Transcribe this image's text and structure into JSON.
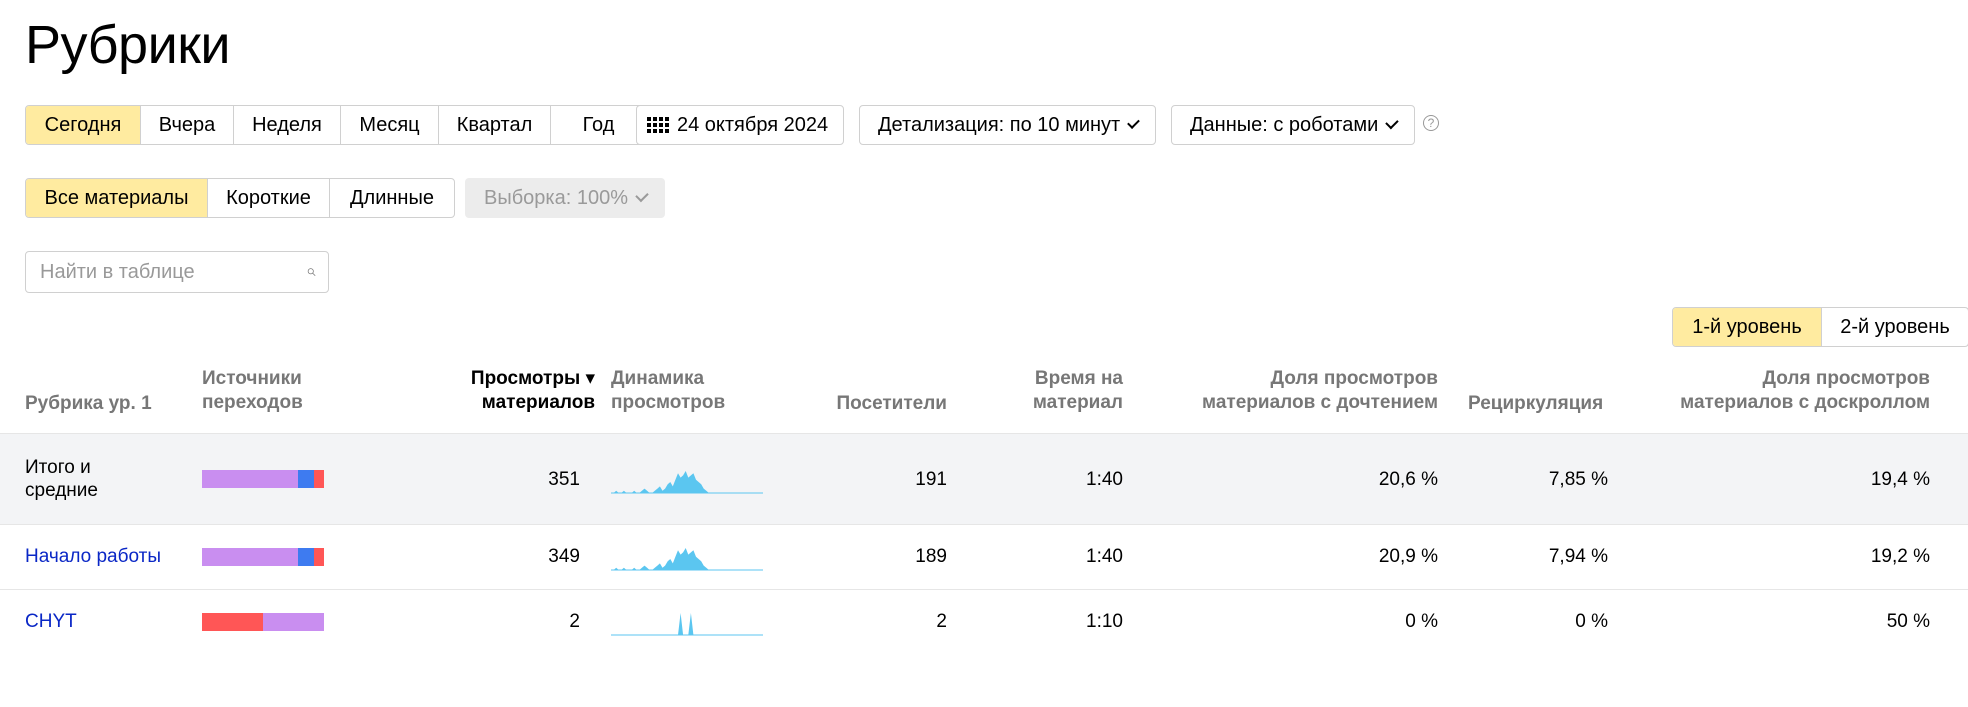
{
  "page": {
    "title": "Рубрики"
  },
  "period": {
    "options": [
      "Сегодня",
      "Вчера",
      "Неделя",
      "Месяц",
      "Квартал",
      "Год"
    ],
    "active": 0
  },
  "date": {
    "label": "24 октября 2024"
  },
  "detail": {
    "label": "Детализация: по 10 минут"
  },
  "data_mode": {
    "label": "Данные: с роботами"
  },
  "help": {
    "symbol": "?"
  },
  "materials": {
    "options": [
      "Все материалы",
      "Короткие",
      "Длинные"
    ],
    "active": 0
  },
  "sample": {
    "label": "Выборка: 100%"
  },
  "search": {
    "placeholder": "Найти в таблице"
  },
  "levels": {
    "options": [
      "1-й уровень",
      "2-й уровень"
    ],
    "active": 0
  },
  "colors": {
    "violet": "#c98ef0",
    "blue": "#3e7bf0",
    "red": "#ff5656",
    "spark": "#5bc6f0",
    "link": "#0a27c6"
  },
  "table": {
    "headers": {
      "rubric": "Рубрика ур. 1",
      "sources": [
        "Источники",
        "переходов"
      ],
      "views": [
        "Просмотры ▾",
        "материалов"
      ],
      "dynamics": [
        "Динамика",
        "просмотров"
      ],
      "visitors": "Посетители",
      "time": [
        "Время на",
        "материал"
      ],
      "read_share": [
        "Доля просмотров",
        "материалов с дочтением"
      ],
      "recirculation": "Рециркуляция",
      "scroll_share": [
        "Доля просмотров",
        "материалов с доскроллом"
      ]
    },
    "rows": [
      {
        "rubric": [
          "Итого и",
          "средние"
        ],
        "sources": [
          {
            "color": "violet",
            "share": 0.79
          },
          {
            "color": "blue",
            "share": 0.13
          },
          {
            "color": "red",
            "share": 0.08
          }
        ],
        "views": "351",
        "visitors": "191",
        "time": "1:40",
        "read_share": "20,6 %",
        "recirculation": "7,85 %",
        "scroll_share": "19,4 %",
        "spark": [
          0,
          0,
          1,
          0,
          0,
          1,
          0,
          0,
          0,
          1,
          0,
          0,
          1,
          2,
          1,
          0,
          0,
          1,
          2,
          3,
          1,
          2,
          4,
          5,
          3,
          6,
          9,
          7,
          8,
          10,
          7,
          8,
          9,
          6,
          5,
          4,
          2,
          1,
          0,
          0,
          0,
          0,
          0,
          0,
          0,
          0,
          0,
          0,
          0,
          0,
          0,
          0,
          0,
          0,
          0,
          0,
          0,
          0,
          0,
          0
        ]
      },
      {
        "rubric": [
          "Начало работы"
        ],
        "sources": [
          {
            "color": "violet",
            "share": 0.79
          },
          {
            "color": "blue",
            "share": 0.13
          },
          {
            "color": "red",
            "share": 0.08
          }
        ],
        "views": "349",
        "visitors": "189",
        "time": "1:40",
        "read_share": "20,9 %",
        "recirculation": "7,94 %",
        "scroll_share": "19,2 %",
        "spark": [
          0,
          0,
          1,
          0,
          0,
          1,
          0,
          0,
          0,
          1,
          0,
          0,
          1,
          2,
          1,
          0,
          0,
          1,
          2,
          3,
          1,
          2,
          4,
          5,
          3,
          6,
          9,
          7,
          8,
          10,
          7,
          8,
          9,
          6,
          5,
          4,
          2,
          1,
          0,
          0,
          0,
          0,
          0,
          0,
          0,
          0,
          0,
          0,
          0,
          0,
          0,
          0,
          0,
          0,
          0,
          0,
          0,
          0,
          0,
          0
        ]
      },
      {
        "rubric": [
          "CHYT"
        ],
        "sources": [
          {
            "color": "red",
            "share": 0.5
          },
          {
            "color": "violet",
            "share": 0.5
          }
        ],
        "views": "2",
        "visitors": "2",
        "time": "1:10",
        "read_share": "0 %",
        "recirculation": "0 %",
        "scroll_share": "50 %",
        "spark": [
          0,
          0,
          0,
          0,
          0,
          0,
          0,
          0,
          0,
          0,
          0,
          0,
          0,
          0,
          0,
          0,
          0,
          0,
          0,
          0,
          0,
          0,
          0,
          0,
          0,
          0,
          0,
          10,
          0,
          0,
          0,
          10,
          0,
          0,
          0,
          0,
          0,
          0,
          0,
          0,
          0,
          0,
          0,
          0,
          0,
          0,
          0,
          0,
          0,
          0,
          0,
          0,
          0,
          0,
          0,
          0,
          0,
          0,
          0,
          0
        ]
      }
    ]
  }
}
